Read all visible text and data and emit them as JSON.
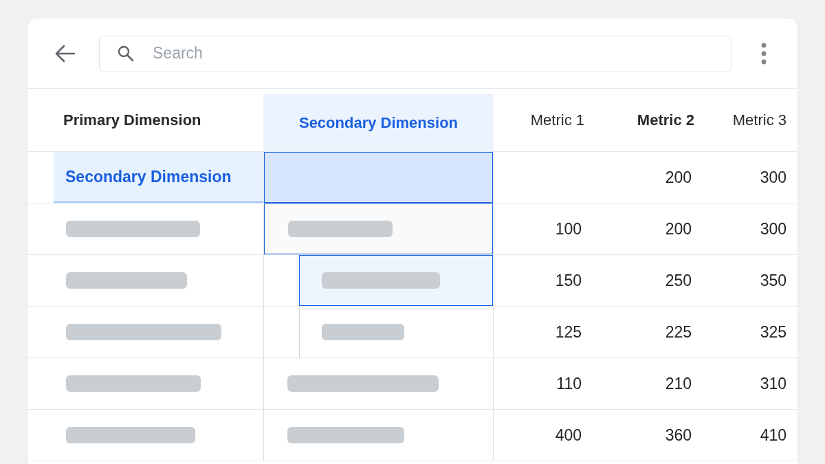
{
  "search": {
    "placeholder": "Search"
  },
  "columns": [
    {
      "label": "Primary Dimension",
      "selected": false,
      "emphasized": true
    },
    {
      "label": "Secondary Dimension",
      "selected": true,
      "emphasized": true
    },
    {
      "label": "Metric 1",
      "selected": false,
      "emphasized": false
    },
    {
      "label": "Metric 2",
      "selected": false,
      "emphasized": true
    },
    {
      "label": "Metric 3",
      "selected": false,
      "emphasized": false
    }
  ],
  "rows": [
    {
      "kind": "dragging",
      "label": "Secondary Dimension",
      "secondary": {
        "kind": "drop-target"
      },
      "metrics": [
        "200",
        "300"
      ]
    },
    {
      "kind": "skeleton",
      "secondary": {
        "kind": "outlined"
      },
      "metrics": [
        "100",
        "200",
        "300"
      ]
    },
    {
      "kind": "skeleton",
      "secondary": {
        "kind": "nested-selected"
      },
      "metrics": [
        "150",
        "250",
        "350"
      ]
    },
    {
      "kind": "skeleton",
      "secondary": {
        "kind": "nested"
      },
      "metrics": [
        "125",
        "225",
        "325"
      ]
    },
    {
      "kind": "skeleton",
      "secondary": {
        "kind": "plain"
      },
      "metrics": [
        "110",
        "210",
        "310"
      ]
    },
    {
      "kind": "skeleton",
      "secondary": {
        "kind": "plain"
      },
      "metrics": [
        "400",
        "360",
        "410"
      ]
    }
  ]
}
